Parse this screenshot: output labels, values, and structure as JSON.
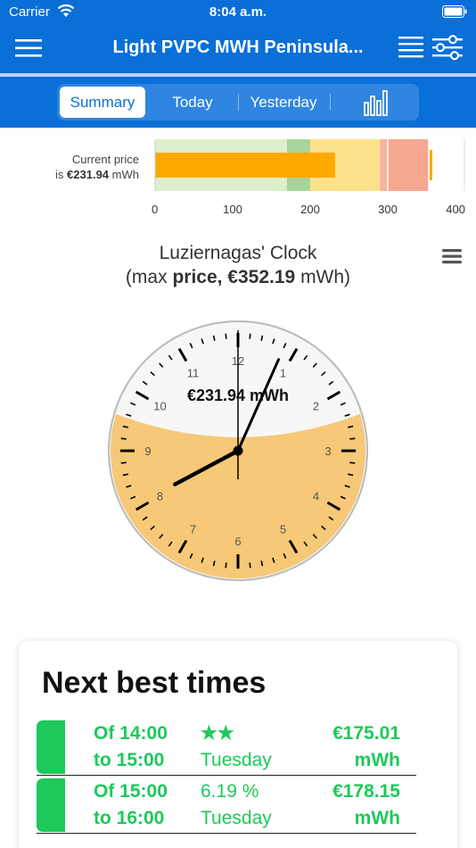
{
  "status_bar": {
    "carrier": "Carrier",
    "time": "8:04 a.m."
  },
  "nav": {
    "title": "Light PVPC MWH Peninsula..."
  },
  "tabs": [
    {
      "label": "Summary",
      "selected": true
    },
    {
      "label": "Today",
      "selected": false
    },
    {
      "label": "Yesterday",
      "selected": false
    },
    {
      "icon": "bar-chart-icon"
    }
  ],
  "current_price": {
    "line1": "Current price",
    "prefix": "is",
    "value_text": "€231.94",
    "unit": "mWh",
    "value": 231.94,
    "axis_ticks": [
      "0",
      "100",
      "200",
      "300",
      "400"
    ],
    "axis_min": 0,
    "axis_max": 400,
    "marker": 354
  },
  "clock": {
    "title": "Luziernagas' Clock",
    "subtitle_open": "(max",
    "subtitle_bold": "price, €352.19",
    "subtitle_close": "mWh)",
    "center_label": "€231.94 mWh",
    "hour_numbers": [
      "12",
      "1",
      "2",
      "3",
      "4",
      "5",
      "6",
      "7",
      "8",
      "9",
      "10",
      "11"
    ],
    "hour": 8,
    "minute": 4,
    "fill_fraction": 0.658,
    "fill_color": "#f6c877"
  },
  "best_times": {
    "title": "Next best times",
    "rows": [
      {
        "from": "Of 14:00",
        "to": "to 15:00",
        "rating": "★★",
        "day": "Tuesday",
        "price": "€175.01",
        "unit": "mWh"
      },
      {
        "from": "Of 15:00",
        "to": "to 16:00",
        "rating": "6.19 %",
        "day": "Tuesday",
        "price": "€178.15",
        "unit": "mWh"
      }
    ]
  },
  "colors": {
    "brand": "#0a6fd6",
    "accent_green": "#1dc95a",
    "bar_orange": "#ffa800"
  }
}
